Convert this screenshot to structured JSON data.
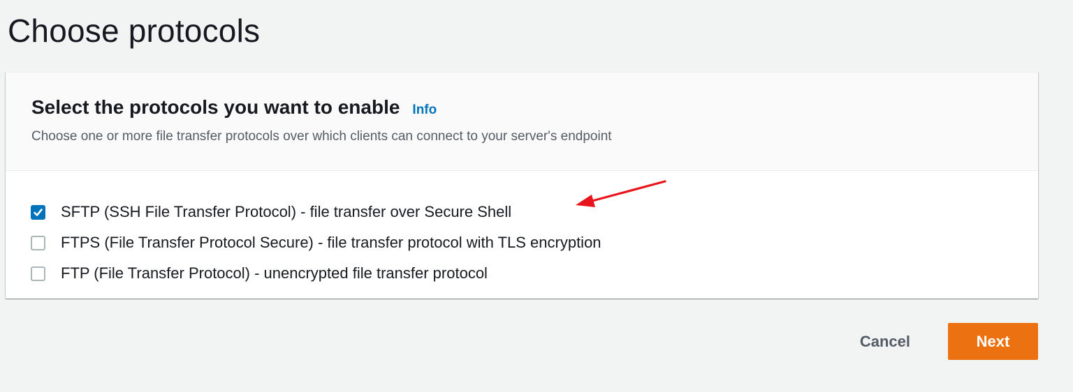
{
  "page": {
    "title": "Choose protocols"
  },
  "panel": {
    "heading": "Select the protocols you want to enable",
    "info_link": "Info",
    "description": "Choose one or more file transfer protocols over which clients can connect to your server's endpoint"
  },
  "protocols": [
    {
      "label": "SFTP (SSH File Transfer Protocol) - file transfer over Secure Shell",
      "checked": true
    },
    {
      "label": "FTPS (File Transfer Protocol Secure) - file transfer protocol with TLS encryption",
      "checked": false
    },
    {
      "label": "FTP (File Transfer Protocol) - unencrypted file transfer protocol",
      "checked": false
    }
  ],
  "actions": {
    "cancel_label": "Cancel",
    "next_label": "Next"
  },
  "colors": {
    "accent": "#ec7211",
    "link": "#0073bb",
    "checkbox_checked": "#0073bb",
    "annotation_arrow": "#e8141b"
  },
  "icons": {
    "checkmark": "check-icon",
    "annotation": "red-arrow-icon"
  }
}
